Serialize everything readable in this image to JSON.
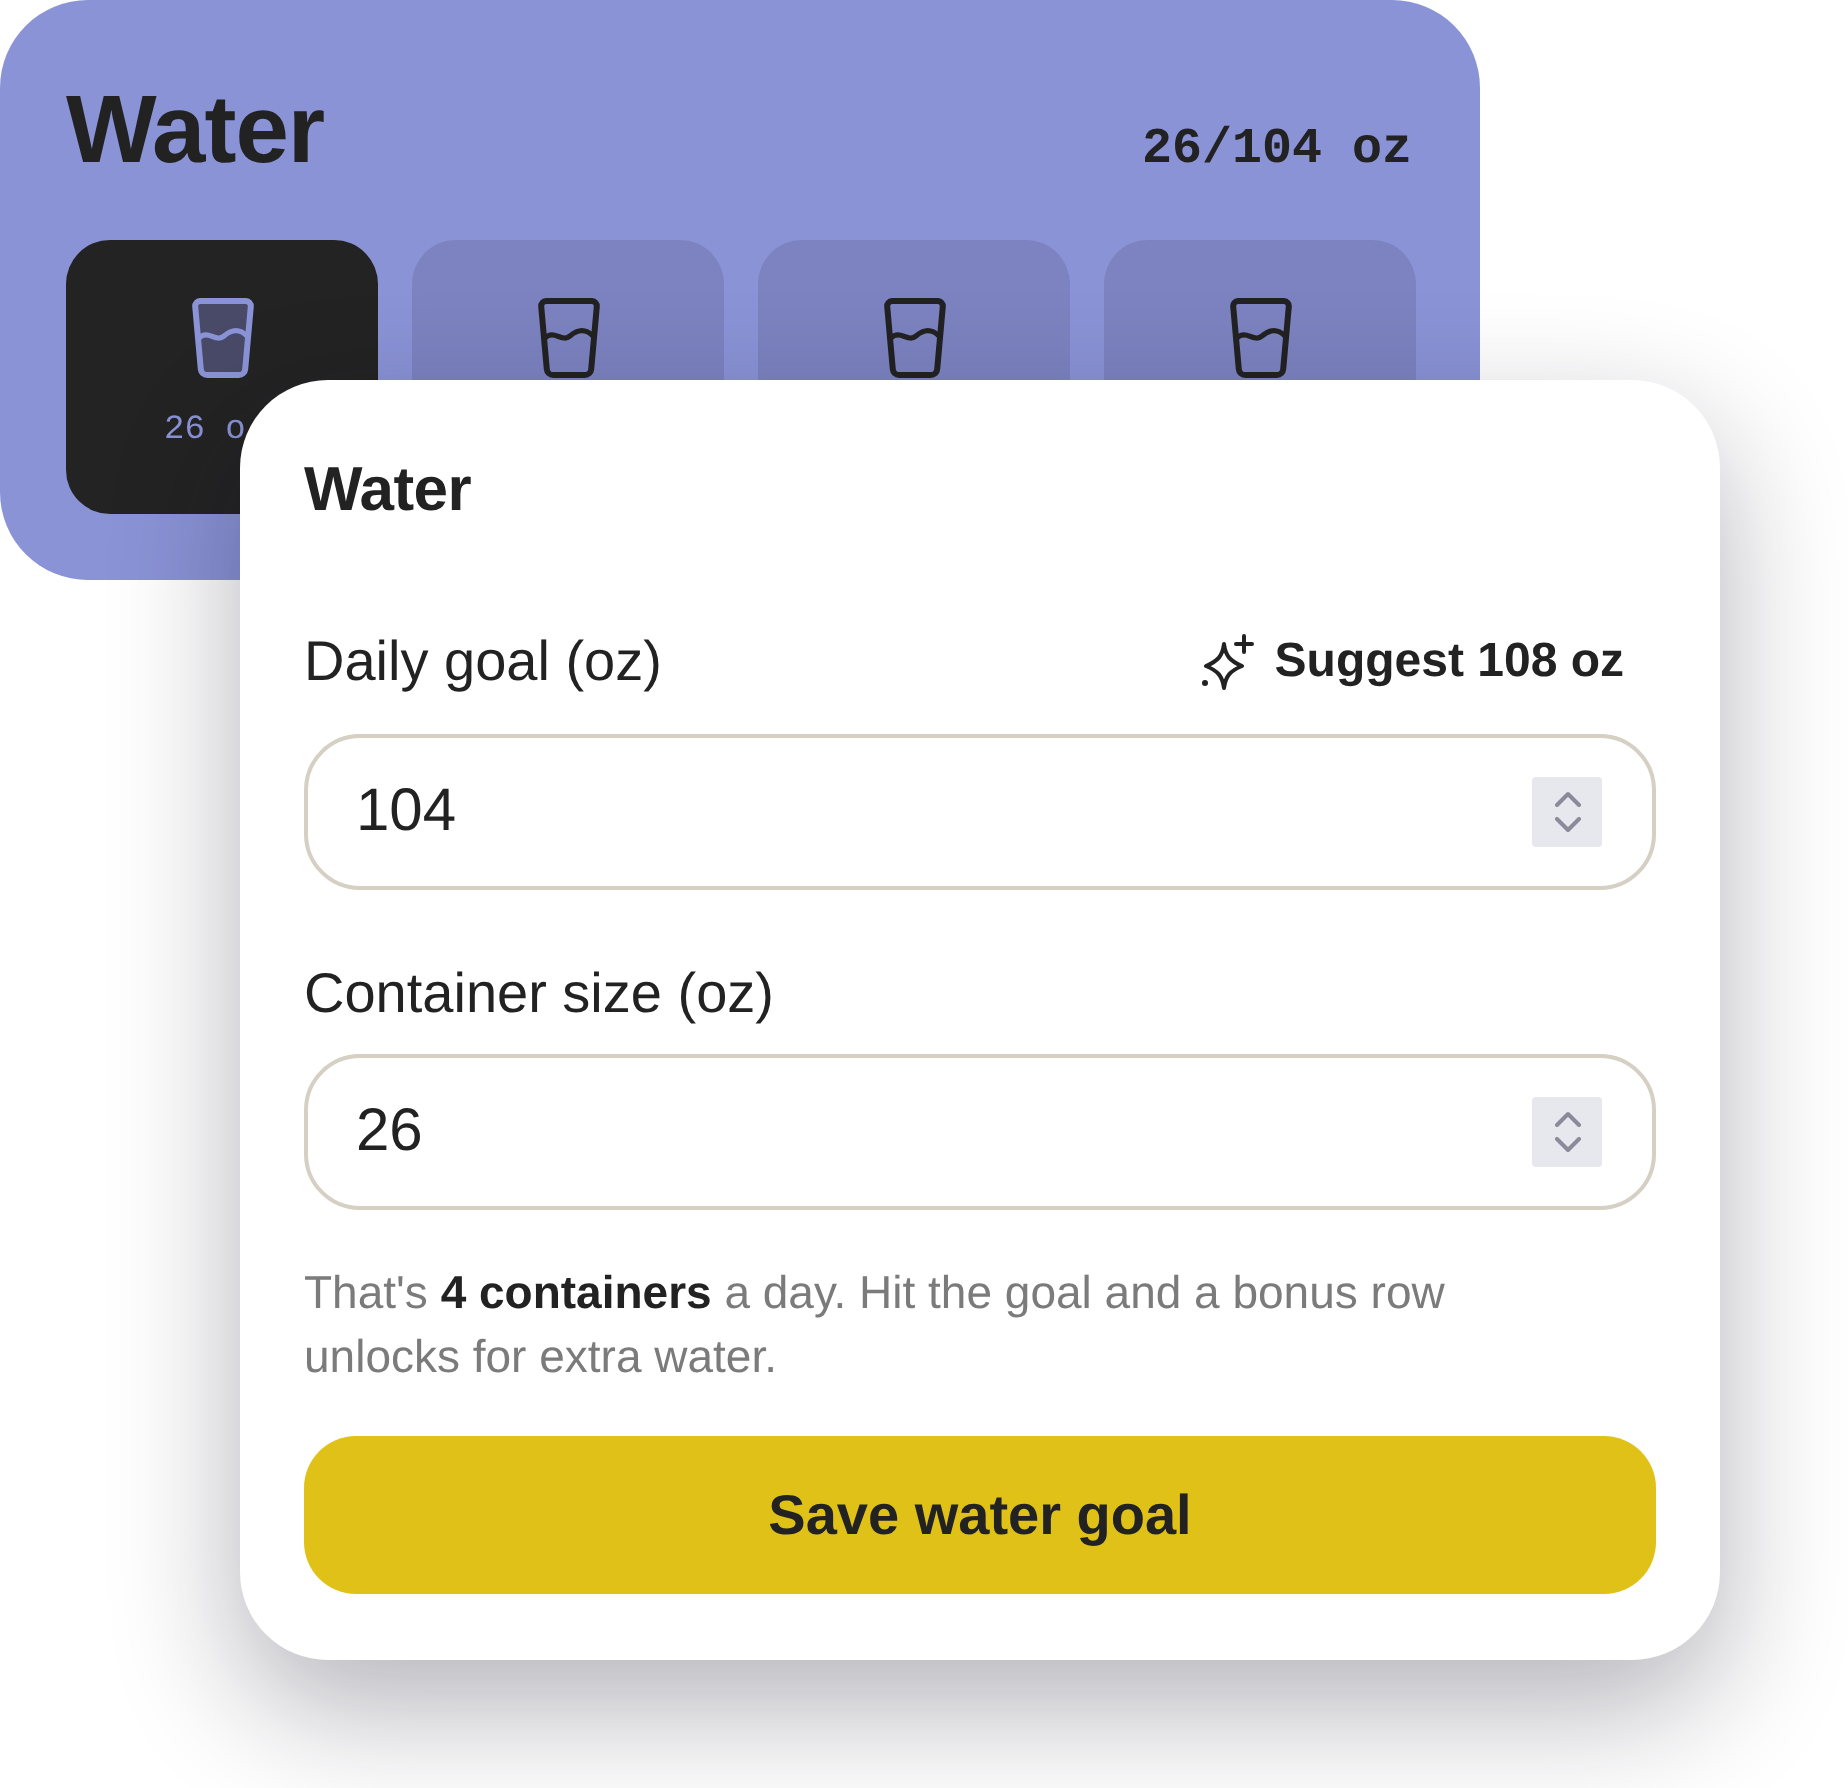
{
  "water_card": {
    "title": "Water",
    "progress": "26/104 oz",
    "containers": [
      {
        "filled": true,
        "label": "26 o"
      },
      {
        "filled": false
      },
      {
        "filled": false
      },
      {
        "filled": false
      }
    ]
  },
  "dialog": {
    "title": "Water",
    "fields": [
      {
        "label": "Daily goal (oz)",
        "value": "104",
        "suggestion": "Suggest 108 oz"
      },
      {
        "label": "Container size (oz)",
        "value": "26"
      }
    ],
    "hint": "That's **4 containers** a day. Hit the goal and a bonus row unlocks for extra water.",
    "button": "Save water goal"
  }
}
